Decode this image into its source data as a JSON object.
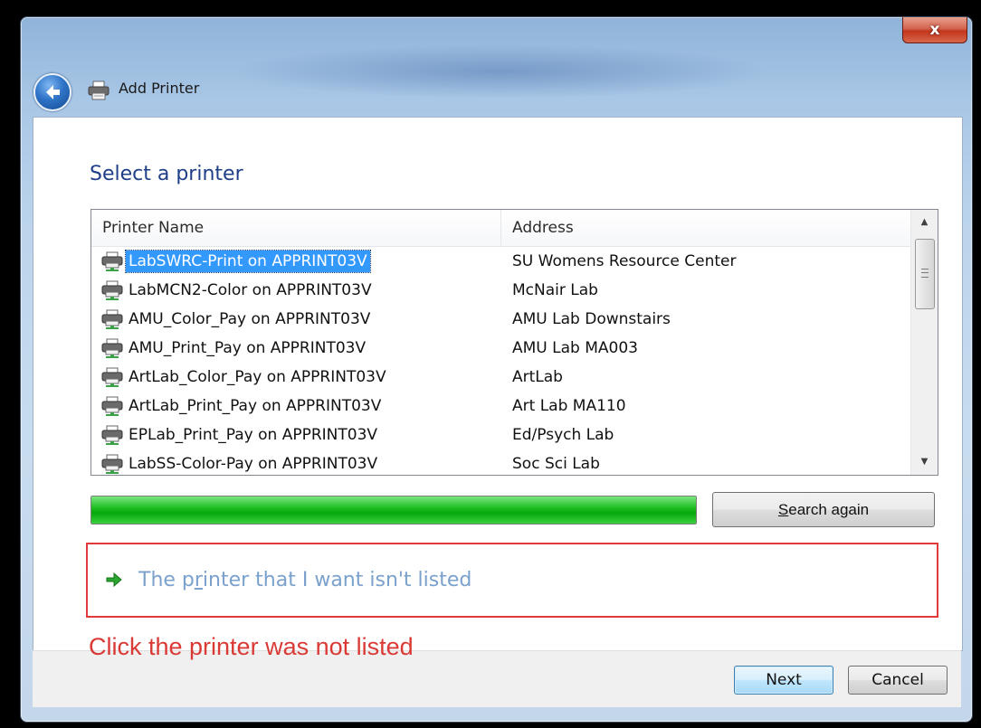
{
  "window": {
    "title": "Add Printer",
    "close_label": "x"
  },
  "page": {
    "heading": "Select a printer"
  },
  "list": {
    "columns": {
      "name": "Printer Name",
      "address": "Address"
    },
    "rows": [
      {
        "name": "LabSWRC-Print on APPRINT03V",
        "address": "SU Womens Resource Center",
        "selected": true
      },
      {
        "name": "LabMCN2-Color on APPRINT03V",
        "address": "McNair Lab"
      },
      {
        "name": "AMU_Color_Pay on APPRINT03V",
        "address": "AMU Lab Downstairs"
      },
      {
        "name": "AMU_Print_Pay on APPRINT03V",
        "address": "AMU Lab MA003"
      },
      {
        "name": "ArtLab_Color_Pay on APPRINT03V",
        "address": "ArtLab"
      },
      {
        "name": "ArtLab_Print_Pay on APPRINT03V",
        "address": "Art Lab MA110"
      },
      {
        "name": "EPLab_Print_Pay on APPRINT03V",
        "address": "Ed/Psych Lab"
      },
      {
        "name": "LabSS-Color-Pay on APPRINT03V",
        "address": "Soc Sci Lab"
      }
    ]
  },
  "progress": {
    "fraction": 1.0,
    "color": "#06a80b"
  },
  "search": {
    "label_underlined": "S",
    "label_rest": "earch again"
  },
  "not_listed": {
    "pre": "The p",
    "underlined": "r",
    "post": "inter that I want isn't listed",
    "color": "#7aa0cc"
  },
  "annotation": {
    "text": "Click the printer was not listed",
    "color": "#d93a35"
  },
  "buttons": {
    "next": "Next",
    "cancel": "Cancel"
  },
  "icons": {
    "back": "back-arrow-icon",
    "title": "printer-icon",
    "row": "network-printer-icon",
    "link": "green-arrow-icon"
  }
}
